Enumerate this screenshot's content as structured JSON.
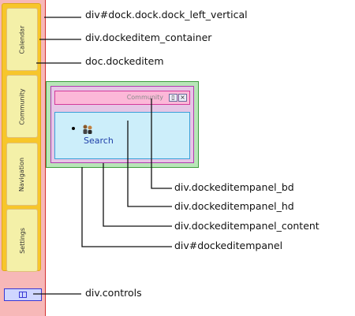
{
  "dock": {
    "items": [
      {
        "label": "Calendar"
      },
      {
        "label": "Community"
      },
      {
        "label": "Navigation"
      },
      {
        "label": "Settings"
      }
    ]
  },
  "panel": {
    "title": "Community",
    "link": "Search"
  },
  "annotations": {
    "dock": "div#dock.dock.dock_left_vertical",
    "container": "div.dockeditem_container",
    "item": "doc.dockeditem",
    "panel_bd": "div.dockeditempanel_bd",
    "panel_hd": "div.dockeditempanel_hd",
    "panel_content": "div.dockeditempanel_content",
    "panel": "div#dockeditempanel",
    "controls": "div.controls"
  },
  "colors": {
    "dock": "#f7b8b8",
    "container": "#f7c62b",
    "item": "#f4f0a8",
    "panel": "#b8e6b8",
    "panel_bd": "#e6c6e6",
    "panel_hd": "#fcb8d8",
    "panel_content": "#cceefa",
    "controls": "#cfd6ff"
  }
}
